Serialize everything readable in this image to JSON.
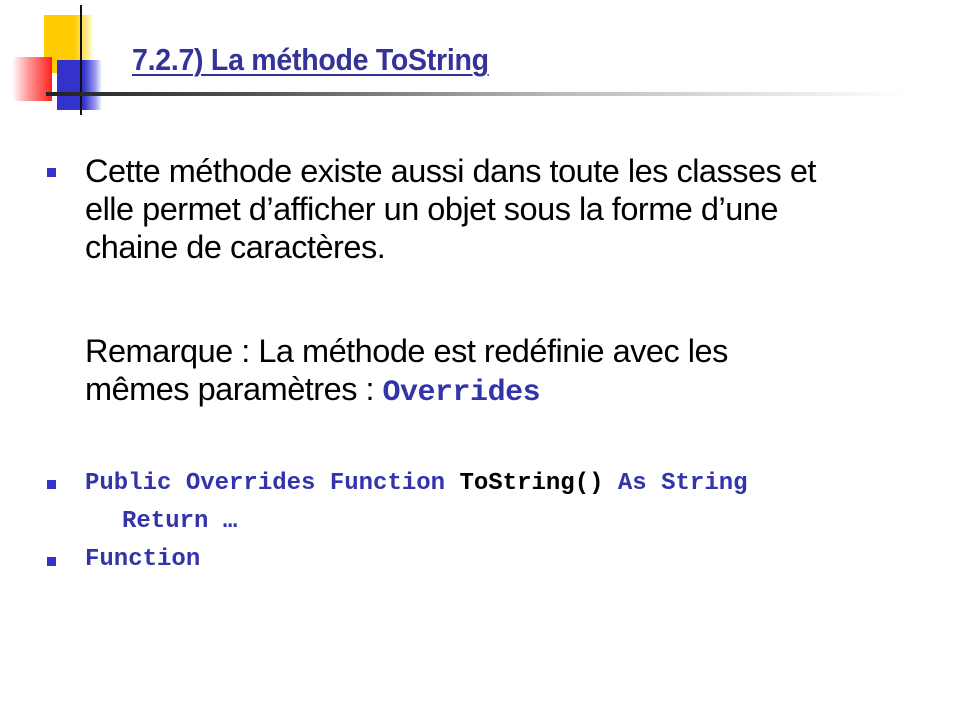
{
  "title": "7.2.7) La méthode ToString",
  "colors": {
    "title": "#333399",
    "bullet": "#3333cc",
    "keyword": "#3333aa"
  },
  "bullets": [
    {
      "lines": [
        "Cette méthode existe aussi dans toute les classes et",
        "elle permet d’afficher un objet sous la forme d’une",
        "chaine de caractères."
      ]
    }
  ],
  "remark": {
    "line1": "Remarque : La méthode est redéfinie avec les",
    "line2": "mêmes paramètres : ",
    "keyword": "Overrides"
  },
  "code": {
    "line1_kw1": "Public Overrides Function ",
    "line1_name": "ToString()",
    "line1_kw2": " As String",
    "line2": "Return …",
    "line3": "Function"
  }
}
